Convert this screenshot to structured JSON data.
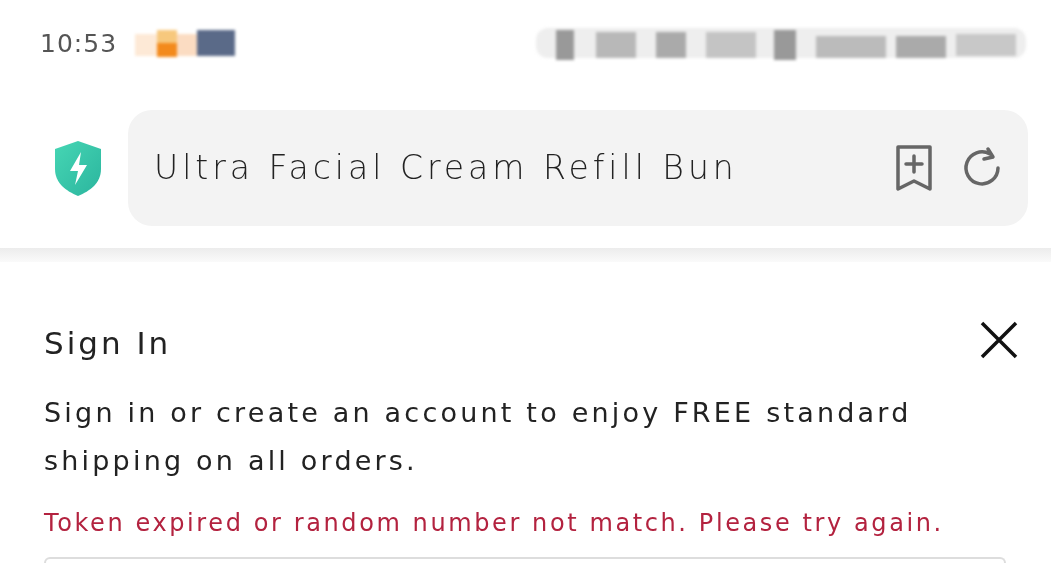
{
  "status_bar": {
    "time": "10:53"
  },
  "address_bar": {
    "title": "Ultra Facial Cream Refill Bun"
  },
  "dialog": {
    "title": "Sign In",
    "message": "Sign in or create an account to enjoy FREE standard shipping on all orders.",
    "error": "Token expired or random number not match. Please try again."
  }
}
